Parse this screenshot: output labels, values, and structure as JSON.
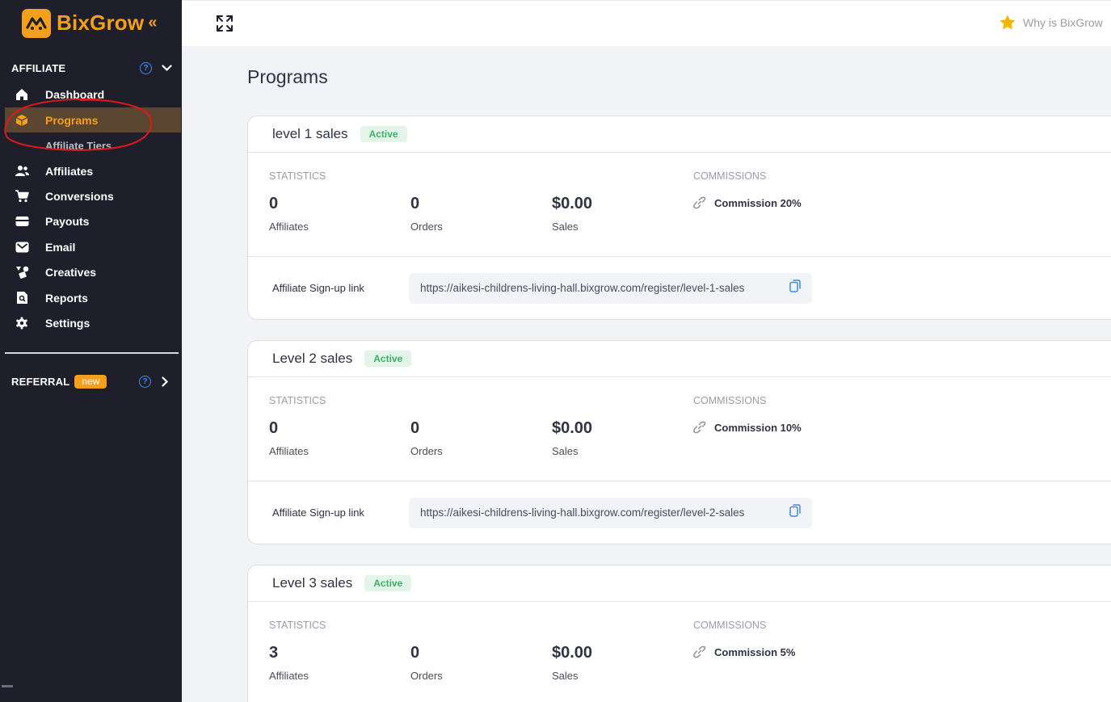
{
  "brand": {
    "name": "BixGrow",
    "collapse_glyph": "«",
    "accent": "#f4a01c"
  },
  "sidebar": {
    "affiliate_section": {
      "title": "AFFILIATE",
      "help": "?"
    },
    "items": [
      {
        "label": "Dashboard",
        "icon": "home-icon"
      },
      {
        "label": "Programs",
        "icon": "box-icon",
        "active": true
      },
      {
        "label": "Affiliate Tiers",
        "sub": true
      },
      {
        "label": "Affiliates",
        "icon": "users-icon"
      },
      {
        "label": "Conversions",
        "icon": "cart-icon"
      },
      {
        "label": "Payouts",
        "icon": "wallet-icon"
      },
      {
        "label": "Email",
        "icon": "mail-icon"
      },
      {
        "label": "Creatives",
        "icon": "shapes-icon"
      },
      {
        "label": "Reports",
        "icon": "report-icon"
      },
      {
        "label": "Settings",
        "icon": "gear-icon"
      }
    ],
    "referral_section": {
      "title": "REFERRAL",
      "badge": "new",
      "help": "?"
    }
  },
  "topbar": {
    "why_text": "Why is BixGrow",
    "star_color": "#f5b400"
  },
  "page": {
    "title": "Programs"
  },
  "programs": [
    {
      "name": "level 1 sales",
      "status": "Active",
      "statistics_caption": "STATISTICS",
      "commissions_caption": "COMMISSIONS",
      "affiliates": "0",
      "affiliates_label": "Affiliates",
      "orders": "0",
      "orders_label": "Orders",
      "sales": "$0.00",
      "sales_label": "Sales",
      "commission": "Commission 20%",
      "signup_label": "Affiliate Sign-up link",
      "signup_link": "https://aikesi-childrens-living-hall.bixgrow.com/register/level-1-sales"
    },
    {
      "name": "Level 2 sales",
      "status": "Active",
      "statistics_caption": "STATISTICS",
      "commissions_caption": "COMMISSIONS",
      "affiliates": "0",
      "affiliates_label": "Affiliates",
      "orders": "0",
      "orders_label": "Orders",
      "sales": "$0.00",
      "sales_label": "Sales",
      "commission": "Commission 10%",
      "signup_label": "Affiliate Sign-up link",
      "signup_link": "https://aikesi-childrens-living-hall.bixgrow.com/register/level-2-sales"
    },
    {
      "name": "Level 3 sales",
      "status": "Active",
      "statistics_caption": "STATISTICS",
      "commissions_caption": "COMMISSIONS",
      "affiliates": "3",
      "affiliates_label": "Affiliates",
      "orders": "0",
      "orders_label": "Orders",
      "sales": "$0.00",
      "sales_label": "Sales",
      "commission": "Commission 5%"
    }
  ]
}
